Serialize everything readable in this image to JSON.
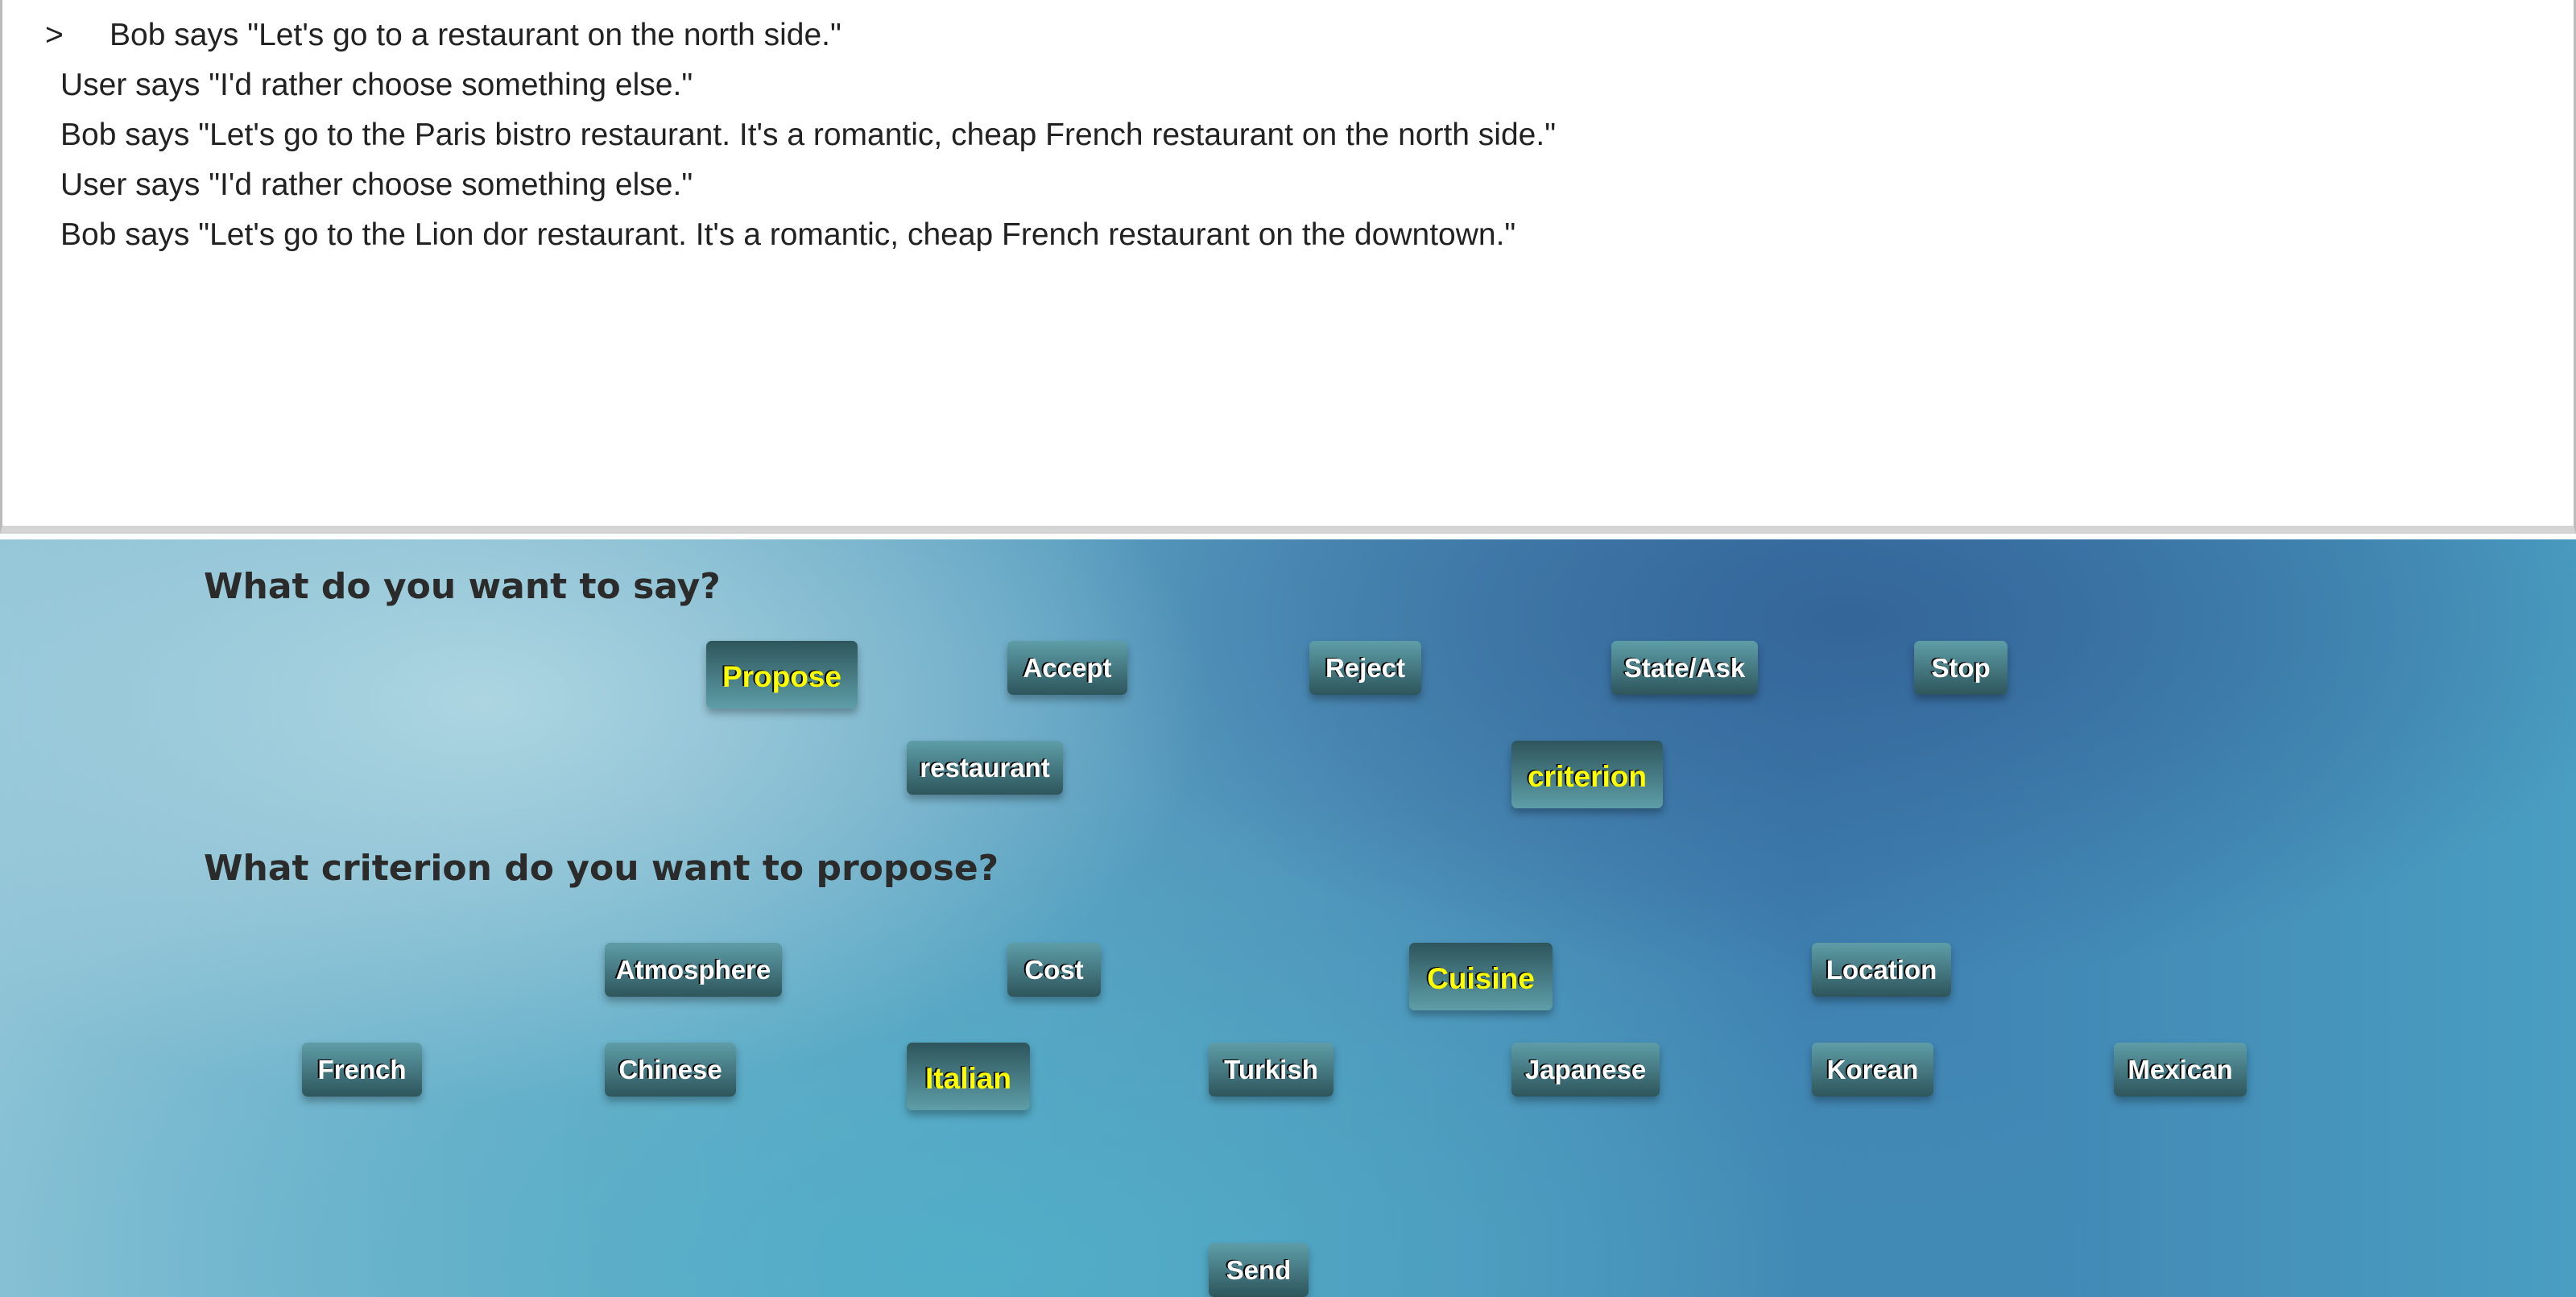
{
  "log": {
    "caret": ">",
    "lines": [
      "Bob says \"Let's go to a restaurant on the north side.\"",
      "User says \"I'd rather choose something else.\"",
      "Bob says \"Let's go to the Paris bistro restaurant. It's a romantic, cheap French restaurant on the north side.\"",
      "User says \"I'd rather choose something else.\"",
      "Bob says \"Let's go to the Lion dor restaurant. It's a romantic, cheap French restaurant on the downtown.\""
    ]
  },
  "say": {
    "question": "What do you want to say?",
    "actions": [
      "Propose",
      "Accept",
      "Reject",
      "State/Ask",
      "Stop"
    ],
    "objects": [
      "restaurant",
      "criterion"
    ]
  },
  "criterion": {
    "question": "What criterion do you want to propose?",
    "criteria": [
      "Atmosphere",
      "Cost",
      "Cuisine",
      "Location"
    ],
    "values": [
      "French",
      "Chinese",
      "Italian",
      "Turkish",
      "Japanese",
      "Korean",
      "Mexican"
    ]
  },
  "send": "Send",
  "selected": [
    "Propose",
    "criterion",
    "Cuisine",
    "Italian"
  ],
  "colors": {
    "selected_text": "#ffff00",
    "button_text": "#ffffff"
  }
}
